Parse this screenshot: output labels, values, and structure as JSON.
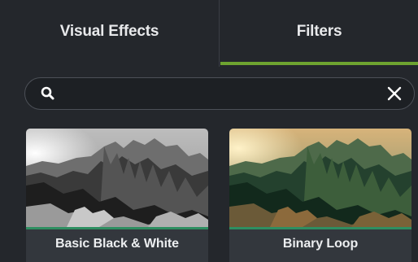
{
  "tabs": [
    {
      "label": "Visual Effects",
      "active": false
    },
    {
      "label": "Filters",
      "active": true
    }
  ],
  "search": {
    "value": "",
    "placeholder": ""
  },
  "filters": [
    {
      "label": "Basic Black & White"
    },
    {
      "label": "Binary Loop"
    }
  ],
  "colors": {
    "background": "#24272c",
    "active_tab_accent": "#6ea330",
    "tile_accent": "#2e8f61",
    "tile_label_bg": "#33373d"
  }
}
